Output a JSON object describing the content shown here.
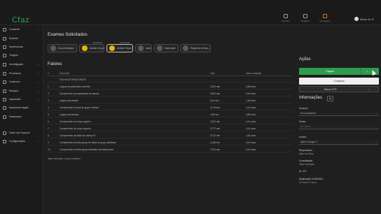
{
  "app": {
    "logo": "Cfaz"
  },
  "topbar": {
    "icons": [
      {
        "name": "grid-icon",
        "label": "Serviços"
      },
      {
        "name": "report-icon",
        "label": "Relatório"
      },
      {
        "name": "message-icon",
        "label": "Mensagens"
      }
    ],
    "user": "Maria do S."
  },
  "sidebar": {
    "items": [
      {
        "label": "Consentir",
        "chev": "⌄"
      },
      {
        "label": "Exames",
        "chev": ""
      },
      {
        "label": "Impressoras",
        "chev": ""
      },
      {
        "label": "Triagem",
        "chev": ""
      },
      {
        "label": "Investigação",
        "chev": "⌄"
      },
      {
        "label": "Processos",
        "chev": "⌄"
      },
      {
        "label": "Coletores",
        "chev": "⌄"
      },
      {
        "label": "Estoque",
        "chev": "⌄"
      },
      {
        "label": "Impressão",
        "chev": "⌄"
      },
      {
        "label": "Assinatura digital",
        "chev": ""
      },
      {
        "label": "Dashboard",
        "chev": ""
      },
      {
        "label": "Falar com Suporte",
        "chev": ""
      },
      {
        "label": "Configurações",
        "chev": "⌄"
      }
    ]
  },
  "main": {
    "title": "Exames Solicitados",
    "steps": [
      {
        "label": "Documentação",
        "tag": "",
        "dot": "grey"
      },
      {
        "label": "Análise Grupo",
        "tag": "Aguardando",
        "dot": "yellow"
      },
      {
        "label": "Análise Grupo",
        "tag": "Aguardando",
        "dot": "yellow"
      },
      {
        "label": "Ação",
        "tag": "",
        "dot": "grey"
      },
      {
        "label": "Impressão",
        "tag": "",
        "dot": "grey"
      },
      {
        "label": "Registros clínicos",
        "tag": "",
        "dot": "grey"
      }
    ],
    "factors_title": "Fatores",
    "table": {
      "headers": [
        "#",
        "Descrição",
        "Valor",
        "Idade avaliação"
      ],
      "rows": [
        {
          "n": "",
          "desc": "FOLHA DE RESULTADOS",
          "valor": "",
          "idade": ""
        },
        {
          "n": "1",
          "desc": "Largura do quilômetro da folha",
          "valor": "15,93 mm",
          "idade": "4,55 anos"
        },
        {
          "n": "2",
          "desc": "Comprimento da capacidade da cabeça",
          "valor": "16,90 mm",
          "idade": "2,34 anos"
        },
        {
          "n": "3",
          "desc": "Largura da metade",
          "valor": "6,61 mm",
          "idade": "1,84 anos"
        },
        {
          "n": "4",
          "desc": "Comprimento do total do grupo I inferior",
          "valor": "11,39 mm",
          "idade": "4,41 anos"
        },
        {
          "n": "5",
          "desc": "Largura da fissuras",
          "valor": "1,89 mm",
          "idade": "4,89 anos"
        },
        {
          "n": "6",
          "desc": "Comprimento do corpo superior",
          "valor": "13,02 mm",
          "idade": "4,21 anos"
        },
        {
          "n": "7",
          "desc": "Comprimento do corpo superior",
          "valor": "27,27 mm",
          "idade": "4,41 anos"
        },
        {
          "n": "8",
          "desc": "Comprimento da distal da cabeça VI",
          "valor": "27,03 mm",
          "idade": "4,18 anos"
        },
        {
          "n": "9",
          "desc": "Comprimento da folha grupo de baixa do grupo atividade",
          "valor": "11,86 mm",
          "idade": "4,21 anos"
        },
        {
          "n": "10",
          "desc": "Comprimento da folha grupo atividade da cabeça total",
          "valor": "12,03 mm",
          "idade": "4,21 anos"
        }
      ]
    },
    "footer_note": "Idade estimada: Todos os fatores"
  },
  "actions": {
    "title": "Ações",
    "primary": "Triagem",
    "secondary": "Comparar",
    "tertiary": "Baixar PDF",
    "chev": "⌄"
  },
  "info": {
    "title": "Informações",
    "button": "⇆",
    "fields": [
      {
        "label": "Situação",
        "value": "Em andamento"
      },
      {
        "label": "Estado",
        "value": "Em aberto"
      },
      {
        "label": "Análise",
        "value": "Maia & Sanger II"
      }
    ],
    "plain": [
      {
        "label": "Responsável",
        "value": "Maria da Silva"
      },
      {
        "label": "Consolidação",
        "value": "Idade estimada"
      },
      {
        "label": "ID: 373",
        "value": ""
      },
      {
        "label": "Atualização: 02/06/2021",
        "value": "15 Nova 17 Nova"
      }
    ]
  }
}
